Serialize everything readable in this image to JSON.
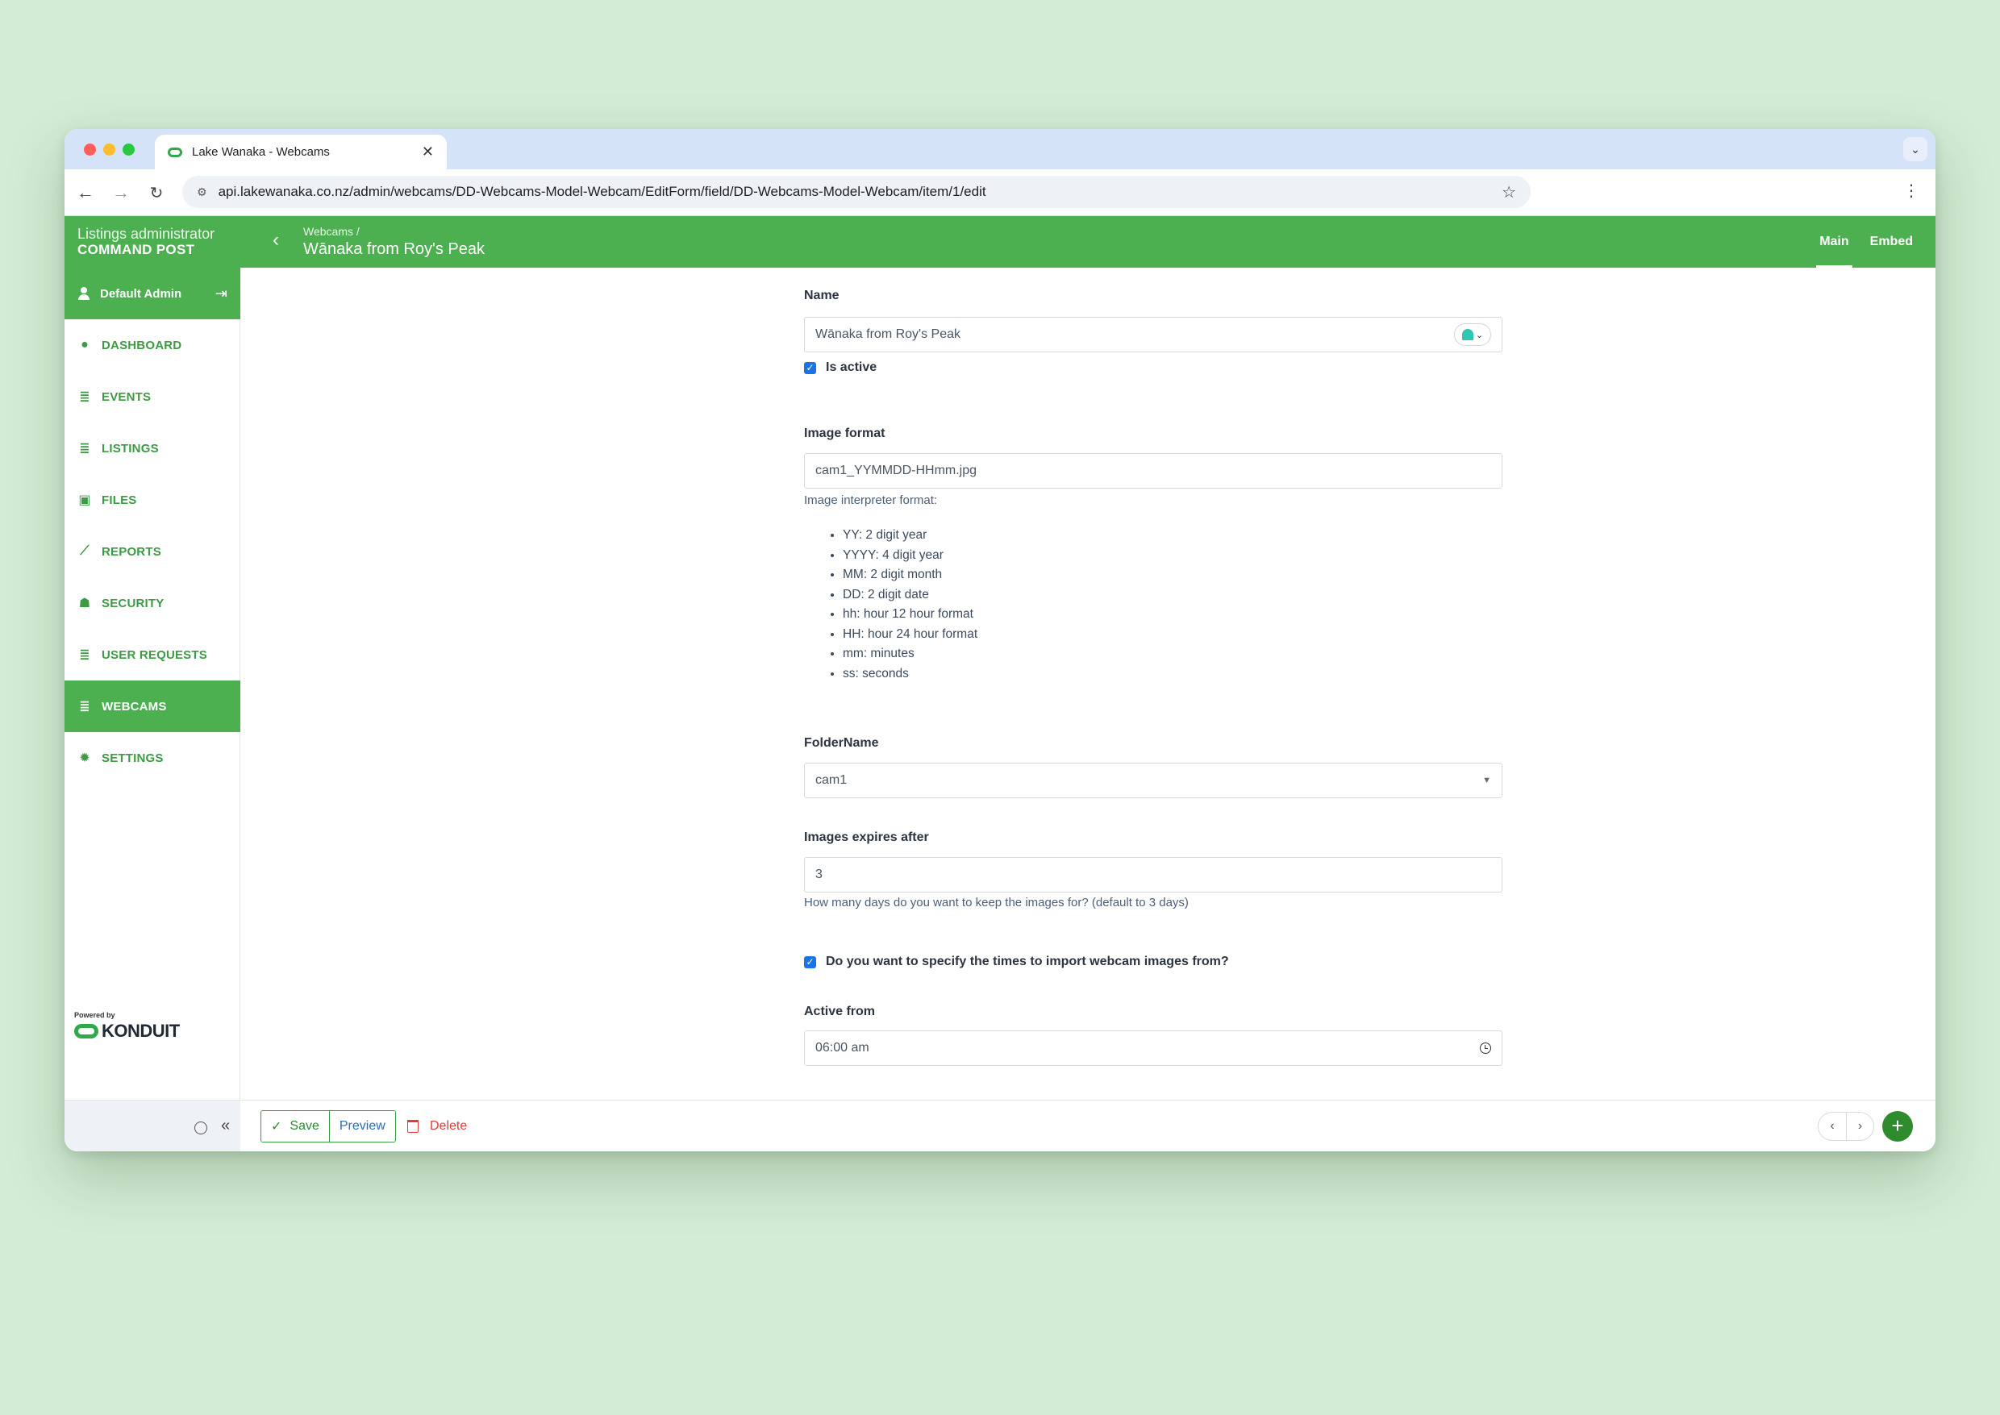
{
  "browser": {
    "tab_title": "Lake Wanaka - Webcams",
    "url": "api.lakewanaka.co.nz/admin/webcams/DD-Webcams-Model-Webcam/EditForm/field/DD-Webcams-Model-Webcam/item/1/edit"
  },
  "header": {
    "brand_sub": "Listings administrator",
    "brand_main": "COMMAND POST",
    "breadcrumb_parent": "Webcams /",
    "page_title": "Wānaka from Roy's Peak",
    "tabs": [
      {
        "label": "Main",
        "active": true
      },
      {
        "label": "Embed",
        "active": false
      }
    ]
  },
  "sidebar": {
    "user": "Default Admin",
    "items": [
      {
        "label": "DASHBOARD",
        "icon": "dashboard-icon",
        "active": false
      },
      {
        "label": "EVENTS",
        "icon": "database-icon",
        "active": false
      },
      {
        "label": "LISTINGS",
        "icon": "database-icon",
        "active": false
      },
      {
        "label": "FILES",
        "icon": "image-icon",
        "active": false
      },
      {
        "label": "REPORTS",
        "icon": "chart-line-icon",
        "active": false
      },
      {
        "label": "SECURITY",
        "icon": "users-icon",
        "active": false
      },
      {
        "label": "USER REQUESTS",
        "icon": "database-icon",
        "active": false
      },
      {
        "label": "WEBCAMS",
        "icon": "database-icon",
        "active": true
      },
      {
        "label": "SETTINGS",
        "icon": "gear-icon",
        "active": false
      }
    ],
    "powered_by": "Powered by",
    "logo_text": "KONDUIT"
  },
  "form": {
    "name_label": "Name",
    "name_value": "Wānaka from Roy's Peak",
    "is_active_label": "Is active",
    "is_active_checked": true,
    "image_format_label": "Image format",
    "image_format_value": "cam1_YYMMDD-HHmm.jpg",
    "interpreter_heading": "Image interpreter format:",
    "format_tokens": [
      "YY: 2 digit year",
      "YYYY: 4 digit year",
      "MM: 2 digit month",
      "DD: 2 digit date",
      "hh: hour 12 hour format",
      "HH: hour 24 hour format",
      "mm: minutes",
      "ss: seconds"
    ],
    "folder_label": "FolderName",
    "folder_value": "cam1",
    "expires_label": "Images expires after",
    "expires_value": "3",
    "expires_help": "How many days do you want to keep the images for? (default to 3 days)",
    "specify_times_label": "Do you want to specify the times to import webcam images from?",
    "specify_times_checked": true,
    "active_from_label": "Active from",
    "active_from_value": "06:00 am"
  },
  "actions": {
    "save": "Save",
    "preview": "Preview",
    "delete": "Delete"
  },
  "colors": {
    "brand_green": "#4caf50",
    "link_green": "#3c9b44",
    "danger": "#e23b3b",
    "add_button": "#2e8b2e"
  }
}
